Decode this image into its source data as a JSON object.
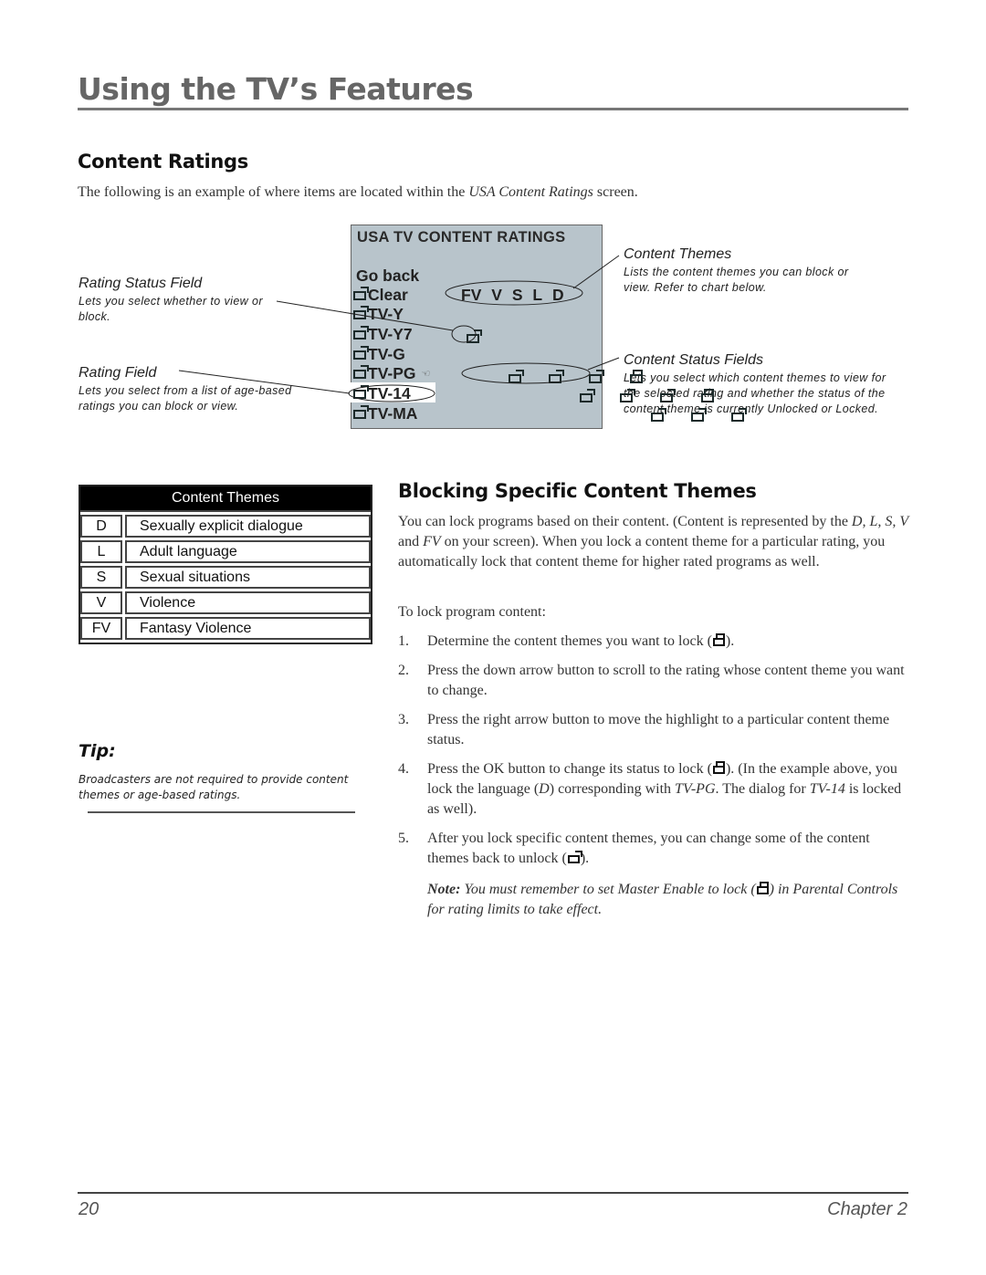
{
  "header": {
    "title": "Using the TV’s Features"
  },
  "section_content_ratings": {
    "heading": "Content Ratings",
    "intro_prefix": "The following is an example of where items are located within the ",
    "intro_italic": "USA Content Ratings",
    "intro_suffix": " screen."
  },
  "tv_screen": {
    "title": "USA TV CONTENT RATINGS",
    "go_back": "Go back",
    "ratings": [
      "Clear",
      "TV-Y",
      "TV-Y7",
      "TV-G",
      "TV-PG",
      "TV-14",
      "TV-MA"
    ],
    "selected_rating": "TV-14",
    "theme_headers": [
      "FV",
      "V",
      "S",
      "L",
      "D"
    ],
    "status_rows": {
      "TV-Y7": [
        "unlocked"
      ],
      "TV-PG": [
        "unlocked",
        "unlocked",
        "unlocked",
        "locked"
      ],
      "TV-14": [
        "unlocked",
        "unlocked",
        "unlocked",
        "locked"
      ],
      "TV-MA": [
        "unlocked",
        "unlocked",
        "unlocked"
      ]
    },
    "pointer_icon": "hand-pointer-icon"
  },
  "callouts": {
    "rating_status_field": {
      "title": "Rating Status Field",
      "desc": "Lets you select whether to view or block."
    },
    "rating_field": {
      "title": "Rating Field",
      "desc": "Lets you select from a list of age-based ratings you can block or view."
    },
    "content_themes": {
      "title": "Content Themes",
      "desc": "Lists the content themes you can block or view. Refer to chart below."
    },
    "content_status_fields": {
      "title": "Content Status Fields",
      "desc": "Lets you select which content themes to view for the selected rating and whether the status of the content theme is currently Unlocked or Locked."
    }
  },
  "content_themes_table": {
    "header": "Content Themes",
    "rows": [
      {
        "code": "D",
        "label": "Sexually explicit dialogue"
      },
      {
        "code": "L",
        "label": "Adult language"
      },
      {
        "code": "S",
        "label": "Sexual situations"
      },
      {
        "code": "V",
        "label": "Violence"
      },
      {
        "code": "FV",
        "label": "Fantasy Violence"
      }
    ]
  },
  "tip": {
    "title": "Tip:",
    "text": "Broadcasters are not required to provide content themes or age-based ratings."
  },
  "section_blocking": {
    "heading": "Blocking Specific Content Themes",
    "p1_a": "You can lock programs based on their content. (Content is represented by the ",
    "p1_b": "D, L, S, V",
    "p1_c": " and ",
    "p1_d": "FV",
    "p1_e": " on your screen). When you lock a content theme for a particular rating, you automatically lock that content theme for higher rated programs as well.",
    "p2": "To lock program content:",
    "steps": [
      {
        "num": "1.",
        "a": "Determine the content themes you want to lock (",
        "b": ")."
      },
      {
        "num": "2.",
        "a": "Press the down arrow button to scroll to the rating whose content theme you want to change."
      },
      {
        "num": "3.",
        "a": "Press the right arrow button to move the highlight to a particular content theme status."
      },
      {
        "num": "4.",
        "a": "Press the OK button to change its status to lock (",
        "b": "). (In the example above, you lock the language (",
        "c": "D",
        "d": ") corresponding with ",
        "e": "TV-PG",
        "f": ". The dialog for ",
        "g": "TV-14",
        "h": " is locked as well)."
      },
      {
        "num": "5.",
        "a": "After you lock specific content themes, you can change some of the content themes back to unlock (",
        "b": ")."
      }
    ],
    "note_label": "Note:",
    "note_a": " You must remember to set Master Enable to lock (",
    "note_b": ") in Parental Controls for rating limits to take effect."
  },
  "footer": {
    "page_number": "20",
    "chapter": "Chapter 2"
  }
}
